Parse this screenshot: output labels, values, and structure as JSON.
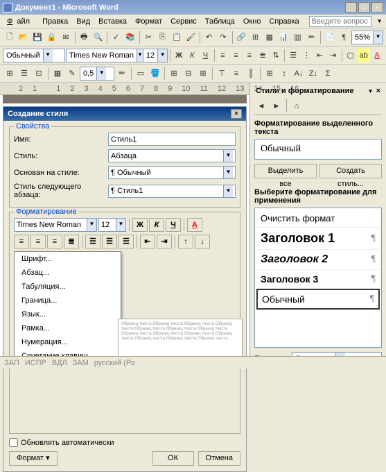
{
  "titlebar": {
    "text": "Документ1 - Microsoft Word"
  },
  "menu": {
    "file": "Файл",
    "edit": "Правка",
    "view": "Вид",
    "insert": "Вставка",
    "format": "Формат",
    "tools": "Сервис",
    "table": "Таблица",
    "window": "Окно",
    "help": "Справка",
    "ask": "Введите вопрос"
  },
  "toolbar1": {
    "zoom": "55%"
  },
  "toolbar2": {
    "style": "Обычный",
    "font": "Times New Roman",
    "size": "12",
    "bold": "Ж",
    "italic": "К",
    "underline": "Ч"
  },
  "toolbar3": {
    "indent": "0,5"
  },
  "ruler_marks": [
    "2",
    "1",
    "",
    "1",
    "2",
    "3",
    "4",
    "5",
    "6",
    "7",
    "8",
    "9",
    "10",
    "11",
    "12",
    "13",
    "14",
    "15",
    "16"
  ],
  "dialog": {
    "title": "Создание стиля",
    "props_legend": "Свойства",
    "name_label": "Имя:",
    "name_value": "Стиль1",
    "type_label": "Стиль:",
    "type_value": "Абзаца",
    "based_label": "Основан на стиле:",
    "based_value": "¶ Обычный",
    "next_label": "Стиль следующего абзаца:",
    "next_value": "¶ Стиль1",
    "fmt_legend": "Форматирование",
    "font": "Times New Roman",
    "size": "12",
    "bold": "Ж",
    "italic": "К",
    "underline": "Ч",
    "menu_items": [
      "Шрифт...",
      "Абзац...",
      "Табуляция...",
      "Граница...",
      "Язык...",
      "Рамка...",
      "Нумерация...",
      "Сочетание клавиш..."
    ],
    "preview": "Образец текста Образец текста Образец текста Образец текста Образец текста Образец текста Образец текста Образец текста Образец текста Образец текста Образец текста Образец текста Образец текста Образец текста",
    "auto_update": "Обновлять автоматически",
    "format_btn": "Формат",
    "ok": "ОК",
    "cancel": "Отмена"
  },
  "pane": {
    "title": "Стили и форматирование",
    "sect1": "Форматирование выделенного текста",
    "current": "Обычный",
    "select_all": "Выделить все",
    "new_style": "Создать стиль...",
    "sect2": "Выберите форматирование для применения",
    "items": [
      {
        "label": "Очистить формат",
        "size": "13px",
        "weight": "normal",
        "style": "normal",
        "para": ""
      },
      {
        "label": "Заголовок 1",
        "size": "18px",
        "weight": "bold",
        "style": "normal",
        "para": "¶"
      },
      {
        "label": "Заголовок 2",
        "size": "16px",
        "weight": "bold",
        "style": "italic",
        "para": "¶"
      },
      {
        "label": "Заголовок 3",
        "size": "14px",
        "weight": "bold",
        "style": "normal",
        "para": "¶"
      },
      {
        "label": "Обычный",
        "size": "14px",
        "weight": "normal",
        "style": "normal",
        "para": "¶",
        "selected": true
      }
    ],
    "show_label": "Показать:",
    "show_value": "Доступное"
  },
  "status": {
    "items": [
      "ЗАП",
      "ИСПР",
      "ВДЛ",
      "ЗАМ",
      "русский (Ро"
    ]
  }
}
